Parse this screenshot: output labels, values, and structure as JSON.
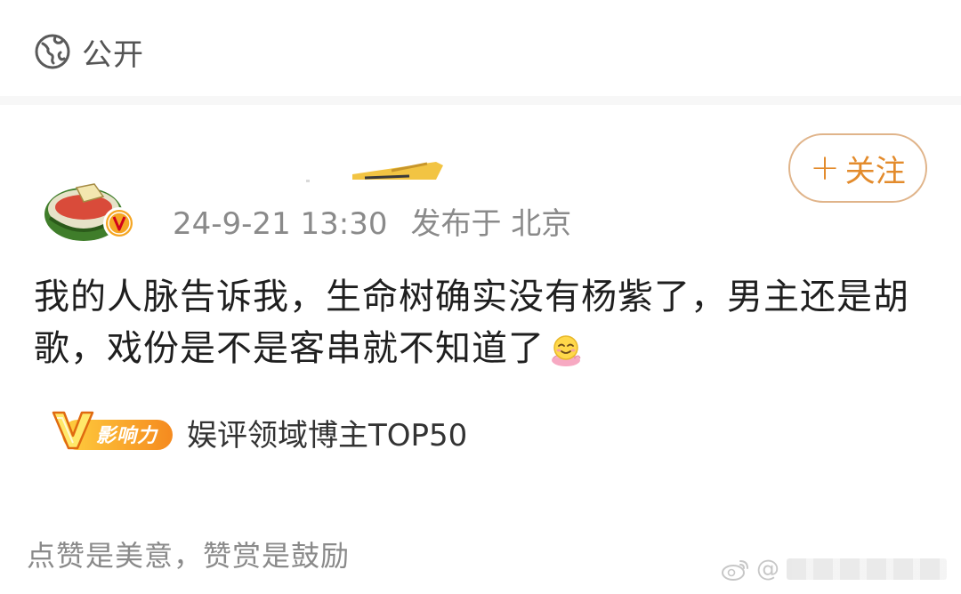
{
  "header": {
    "visibility_label": "公开",
    "visibility_icon": "globe-icon"
  },
  "post": {
    "timestamp": "24-9-21 13:30",
    "location_text": "发布于 北京",
    "follow_label": "关注",
    "text": "我的人脉告诉我，生命树确实没有杨紫了，男主还是胡歌，戏份是不是客串就不知道了",
    "text_emoji": "smiling-face-emoji-icon"
  },
  "influence": {
    "badge_letter": "V",
    "badge_text": "影响力",
    "label": "娱评领域博主TOP50"
  },
  "footer": {
    "appreciation_text": "点赞是美意，赞赏是鼓励",
    "watermark_prefix": "@"
  },
  "colors": {
    "accent_orange": "#e38b2c",
    "follow_border": "#e0b48a",
    "meta_gray": "#8a8a8a",
    "badge_orange": "#f5a623"
  }
}
